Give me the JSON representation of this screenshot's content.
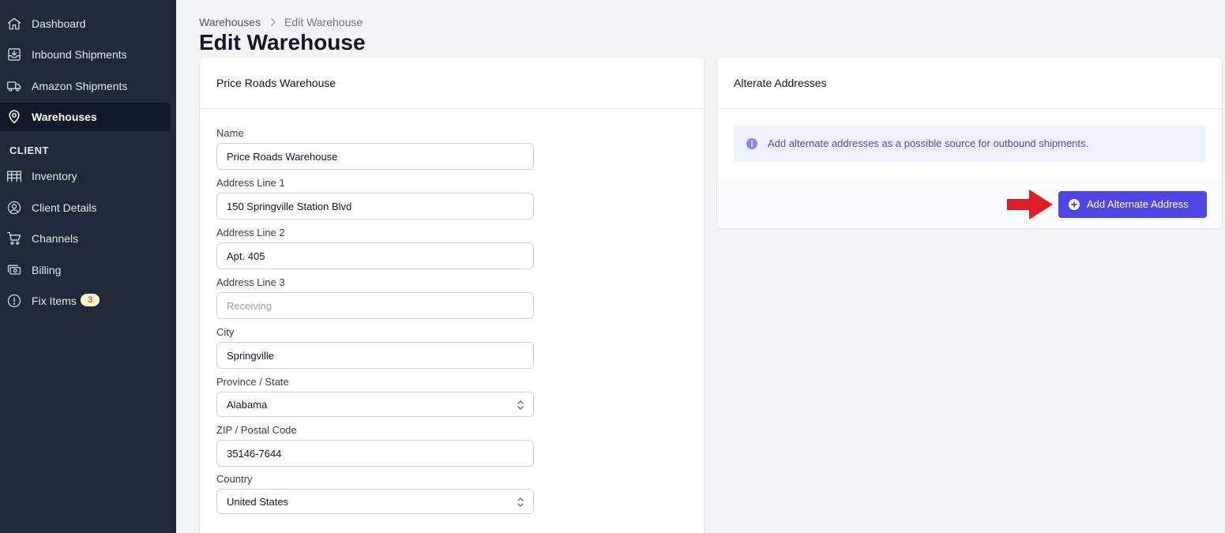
{
  "sidebar": {
    "items": [
      {
        "label": "Dashboard",
        "icon": "home-icon"
      },
      {
        "label": "Inbound Shipments",
        "icon": "inbox-download-icon"
      },
      {
        "label": "Amazon Shipments",
        "icon": "truck-icon"
      },
      {
        "label": "Warehouses",
        "icon": "location-pin-icon"
      }
    ],
    "section_label": "CLIENT",
    "client_items": [
      {
        "label": "Inventory",
        "icon": "warehouse-shelves-icon"
      },
      {
        "label": "Client Details",
        "icon": "user-circle-icon"
      },
      {
        "label": "Channels",
        "icon": "cart-icon"
      },
      {
        "label": "Billing",
        "icon": "cash-icon"
      },
      {
        "label": "Fix Items",
        "icon": "exclamation-circle-icon",
        "badge": "3"
      }
    ],
    "active": "Warehouses"
  },
  "breadcrumb": {
    "parent": "Warehouses",
    "current": "Edit Warehouse"
  },
  "page_title": "Edit Warehouse",
  "form": {
    "header": "Price Roads Warehouse",
    "fields": {
      "name": {
        "label": "Name",
        "value": "Price Roads Warehouse"
      },
      "address1": {
        "label": "Address Line 1",
        "value": "150 Springville Station Blvd"
      },
      "address2": {
        "label": "Address Line 2",
        "value": "Apt. 405"
      },
      "address3": {
        "label": "Address Line 3",
        "value": "",
        "placeholder": "Receiving"
      },
      "city": {
        "label": "City",
        "value": "Springville"
      },
      "state": {
        "label": "Province / State",
        "value": "Alabama"
      },
      "zip": {
        "label": "ZIP / Postal Code",
        "value": "35146-7644"
      },
      "country": {
        "label": "Country",
        "value": "United States"
      }
    }
  },
  "alternate": {
    "header": "Alterate Addresses",
    "info": "Add alternate addresses as a possible source for outbound shipments.",
    "button_label": "Add Alternate Address"
  },
  "colors": {
    "sidebar_bg": "#1f2937",
    "accent": "#4f46e5",
    "arrow": "#e11d2a",
    "badge_bg": "#fef3c7"
  }
}
